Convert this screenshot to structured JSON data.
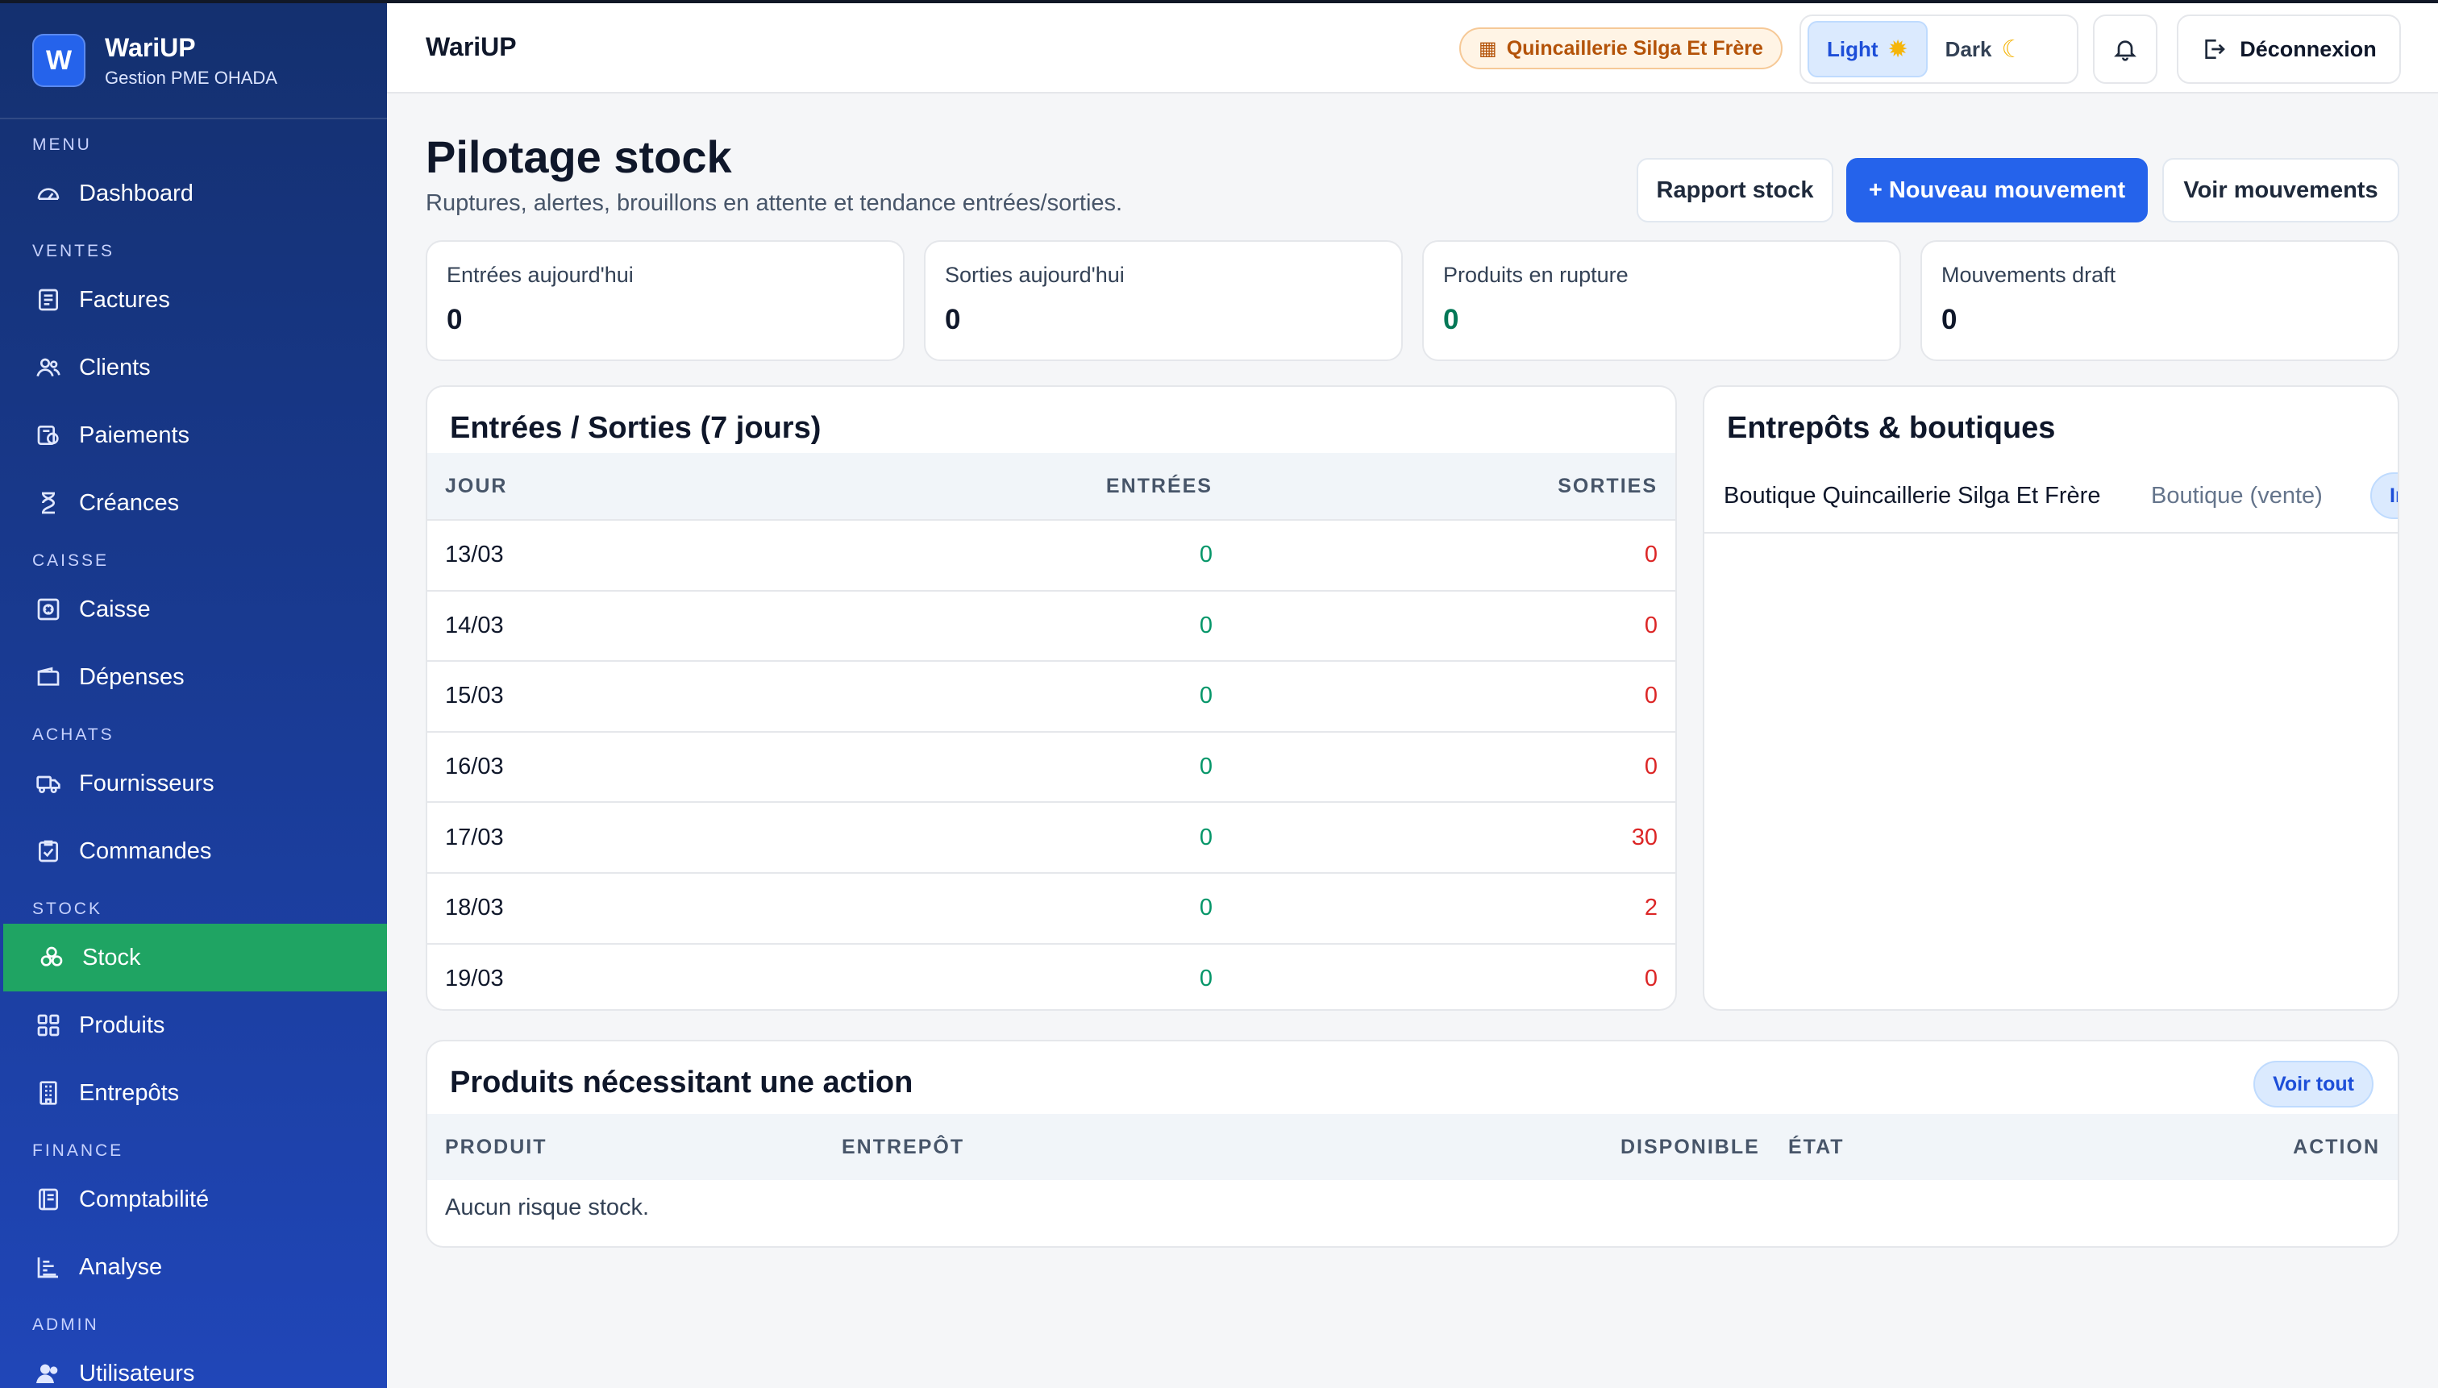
{
  "brand": {
    "logo_letter": "W",
    "name": "WariUP",
    "subtitle": "Gestion PME OHADA"
  },
  "sidebar": {
    "sections": [
      {
        "title": "MENU",
        "items": [
          {
            "label": "Dashboard",
            "icon": "gauge-icon"
          }
        ]
      },
      {
        "title": "VENTES",
        "items": [
          {
            "label": "Factures",
            "icon": "invoice-icon"
          },
          {
            "label": "Clients",
            "icon": "users-icon"
          },
          {
            "label": "Paiements",
            "icon": "payment-icon"
          },
          {
            "label": "Créances",
            "icon": "hourglass-icon"
          }
        ]
      },
      {
        "title": "CAISSE",
        "items": [
          {
            "label": "Caisse",
            "icon": "safe-icon"
          },
          {
            "label": "Dépenses",
            "icon": "wallet-icon"
          }
        ]
      },
      {
        "title": "ACHATS",
        "items": [
          {
            "label": "Fournisseurs",
            "icon": "truck-icon"
          },
          {
            "label": "Commandes",
            "icon": "clipboard-check-icon"
          }
        ]
      },
      {
        "title": "STOCK",
        "items": [
          {
            "label": "Stock",
            "icon": "boxes-icon",
            "active": true
          },
          {
            "label": "Produits",
            "icon": "grid-icon"
          },
          {
            "label": "Entrepôts",
            "icon": "building-icon"
          }
        ]
      },
      {
        "title": "FINANCE",
        "items": [
          {
            "label": "Comptabilité",
            "icon": "ledger-icon"
          },
          {
            "label": "Analyse",
            "icon": "chart-bars-icon"
          }
        ]
      },
      {
        "title": "ADMIN",
        "items": [
          {
            "label": "Utilisateurs",
            "icon": "user-group-icon"
          }
        ]
      }
    ]
  },
  "header": {
    "title": "WariUP",
    "company": "Quincaillerie Silga Et Frère",
    "theme_light": "Light",
    "theme_dark": "Dark",
    "logout": "Déconnexion"
  },
  "page": {
    "title": "Pilotage stock",
    "subtitle": "Ruptures, alertes, brouillons en attente et tendance entrées/sorties.",
    "buttons": {
      "report": "Rapport stock",
      "new_movement": "+ Nouveau mouvement",
      "view_movements": "Voir mouvements"
    }
  },
  "kpis": [
    {
      "label": "Entrées aujourd'hui",
      "value": "0"
    },
    {
      "label": "Sorties aujourd'hui",
      "value": "0"
    },
    {
      "label": "Produits en rupture",
      "value": "0"
    },
    {
      "label": "Mouvements draft",
      "value": "0"
    }
  ],
  "flows": {
    "title": "Entrées / Sorties (7 jours)",
    "columns": {
      "day": "JOUR",
      "in": "ENTRÉES",
      "out": "SORTIES"
    },
    "rows": [
      {
        "day": "13/03",
        "in": "0",
        "out": "0"
      },
      {
        "day": "14/03",
        "in": "0",
        "out": "0"
      },
      {
        "day": "15/03",
        "in": "0",
        "out": "0"
      },
      {
        "day": "16/03",
        "in": "0",
        "out": "0"
      },
      {
        "day": "17/03",
        "in": "0",
        "out": "30"
      },
      {
        "day": "18/03",
        "in": "0",
        "out": "2"
      },
      {
        "day": "19/03",
        "in": "0",
        "out": "0"
      }
    ]
  },
  "warehouses": {
    "title": "Entrepôts & boutiques",
    "items": [
      {
        "name": "Boutique Quincaillerie Silga Et Frère",
        "type": "Boutique (vente)",
        "badge": "In"
      }
    ]
  },
  "actions": {
    "title": "Produits nécessitant une action",
    "view_all": "Voir tout",
    "columns": {
      "product": "PRODUIT",
      "warehouse": "ENTREPÔT",
      "available": "DISPONIBLE",
      "state": "ÉTAT",
      "action": "ACTION"
    },
    "empty": "Aucun risque stock."
  },
  "colors": {
    "accent": "#2563eb",
    "sidebar": "#1a3c98",
    "active": "#1fa463",
    "in": "#059669",
    "out": "#dc2626"
  }
}
